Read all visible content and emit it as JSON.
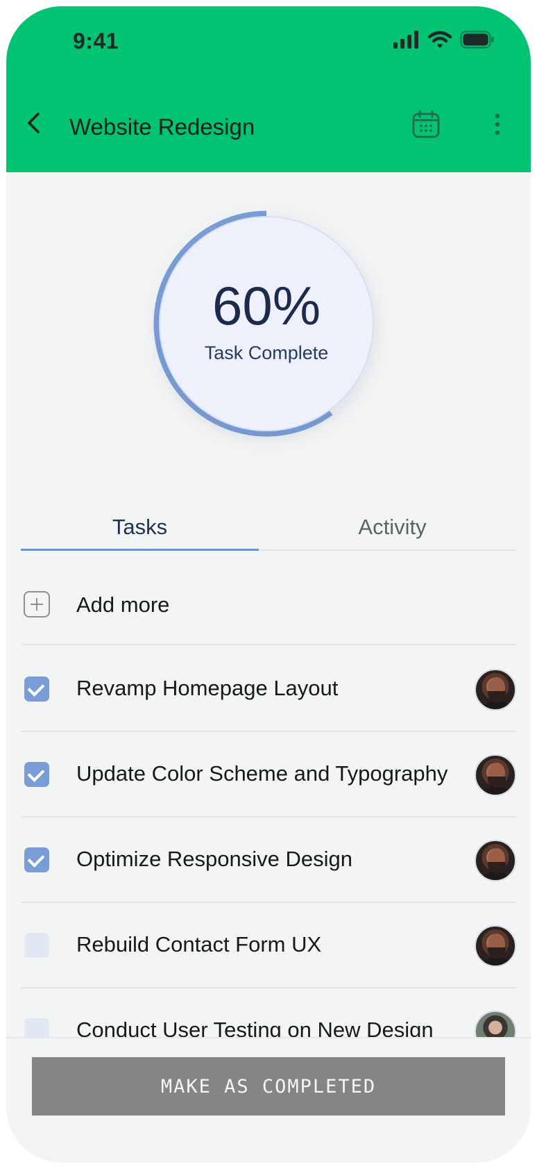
{
  "status_bar": {
    "time": "9:41"
  },
  "app_bar": {
    "title": "Website Redesign"
  },
  "progress": {
    "percent_label": "60%",
    "label": "Task Complete",
    "value": 0.6
  },
  "tabs": [
    {
      "label": "Tasks",
      "active": true
    },
    {
      "label": "Activity",
      "active": false
    }
  ],
  "add_more": {
    "label": "Add more"
  },
  "tasks": [
    {
      "label": "Revamp Homepage Layout",
      "done": true
    },
    {
      "label": "Update Color Scheme and Typography",
      "done": true
    },
    {
      "label": "Optimize Responsive Design",
      "done": true
    },
    {
      "label": "Rebuild Contact Form UX",
      "done": false
    },
    {
      "label": "Conduct User Testing on New Design",
      "done": false
    }
  ],
  "action": {
    "label": "MAKE AS COMPLETED"
  },
  "colors": {
    "brand": "#02c372",
    "accent": "#7b9dd7",
    "ring": "#7a9ed6",
    "button": "#838586"
  }
}
